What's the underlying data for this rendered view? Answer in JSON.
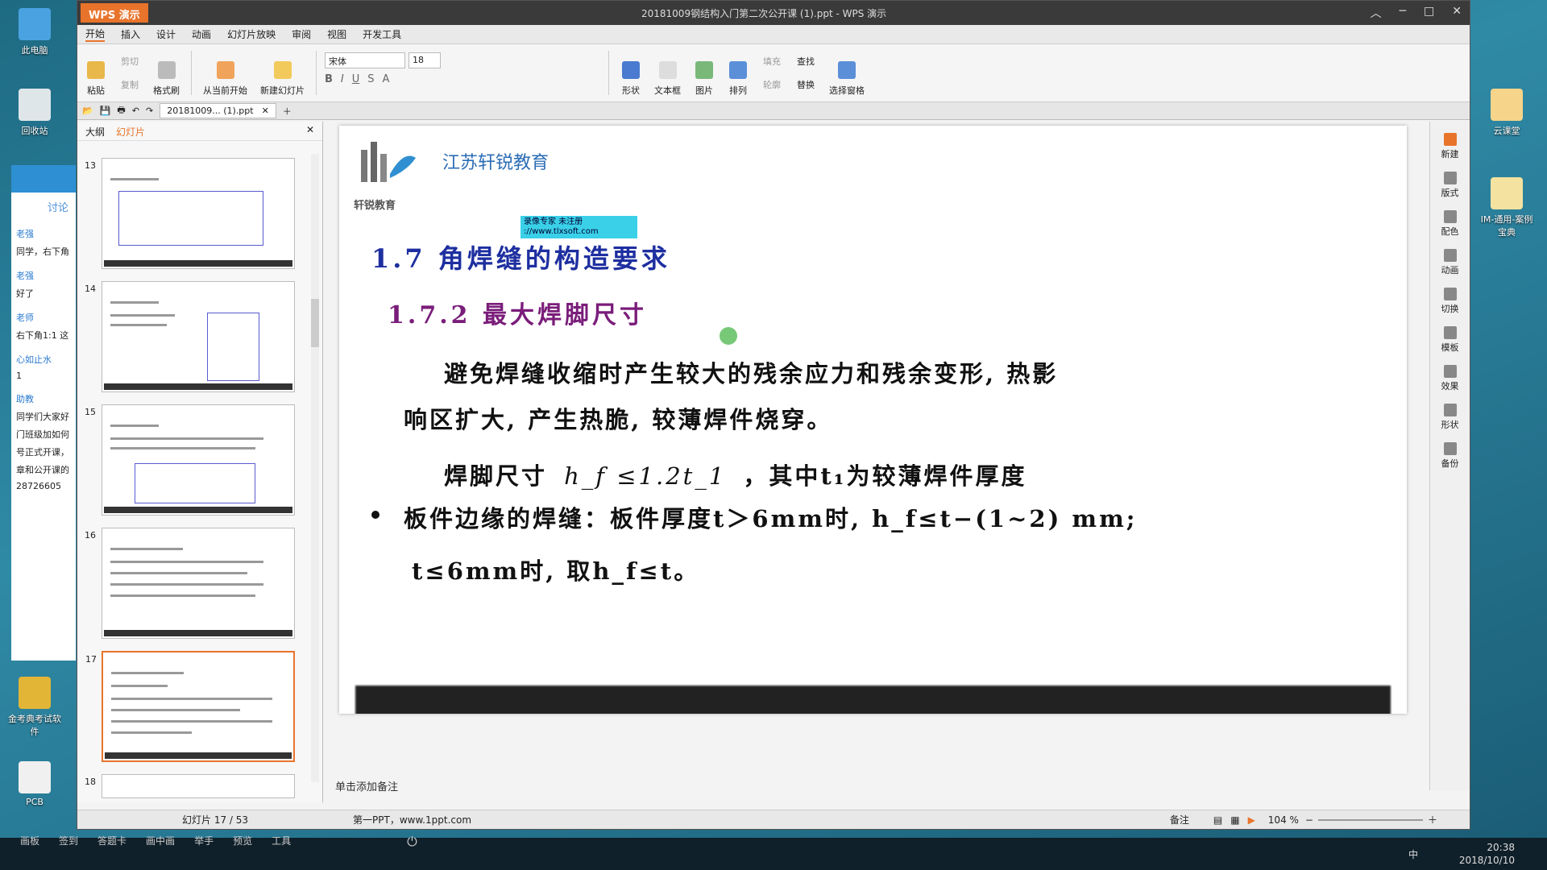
{
  "desktop": {
    "icons": [
      {
        "label": "此电脑"
      },
      {
        "label": "回收站"
      },
      {
        "label": "金考典考试软件"
      },
      {
        "label": "PCB"
      },
      {
        "label": "云课堂"
      },
      {
        "label": "IM-通用-案例宝典"
      }
    ]
  },
  "chat": {
    "tab": "讨论",
    "messages": [
      {
        "name": "老强",
        "text": "同学，右下角"
      },
      {
        "name": "老强",
        "text": "好了"
      },
      {
        "name": "老师",
        "text": "右下角1:1 这"
      },
      {
        "name": "心如止水",
        "text": "1"
      },
      {
        "name": "助教",
        "text": "同学们大家好"
      },
      {
        "name": "",
        "text": "门班级加如何"
      },
      {
        "name": "",
        "text": "号正式开课，"
      },
      {
        "name": "",
        "text": "章和公开课的"
      },
      {
        "name": "",
        "text": "28726605"
      }
    ]
  },
  "window": {
    "app_button": "WPS 演示",
    "title": "20181009钢结构入门第二次公开课 (1).ppt - WPS 演示",
    "menu": [
      "开始",
      "插入",
      "设计",
      "动画",
      "幻灯片放映",
      "审阅",
      "视图",
      "开发工具"
    ],
    "ribbon": {
      "paste": "粘贴",
      "cut": "剪切",
      "copy": "复制",
      "format_painter": "格式刷",
      "from_current": "从当前开始",
      "new_slide": "新建幻灯片",
      "font_name": "宋体",
      "font_size": "18",
      "shape": "形状",
      "textbox": "文本框",
      "picture": "图片",
      "arrange": "排列",
      "fill": "填充",
      "outline": "轮廓",
      "find": "查找",
      "replace": "替换",
      "selection_pane": "选择窗格"
    },
    "doc_tab": "20181009... (1).ppt"
  },
  "side": {
    "tab_outline": "大纲",
    "tab_slides": "幻灯片",
    "thumbs": [
      "13",
      "14",
      "15",
      "16",
      "17",
      "18"
    ]
  },
  "slide": {
    "org": "江苏轩锐教育",
    "logo_text": "轩锐教育",
    "watermark_line1": "录像专家   未注册",
    "watermark_line2": "://www.tlxsoft.com",
    "heading1": "1.7   角焊缝的构造要求",
    "heading2": "1.7.2   最大焊脚尺寸",
    "para1": "避免焊缝收缩时产生较大的残余应力和残余变形, 热影",
    "para2": "响区扩大, 产生热脆, 较薄焊件烧穿。",
    "formula_pre": "焊脚尺寸",
    "formula": "h_f ≤1.2t_1",
    "formula_post": "，其中t₁为较薄焊件厚度",
    "bullet1": "板件边缘的焊缝：板件厚度t＞6mm时, h_f≤t−(1~2) mm;",
    "bullet2": "t≤6mm时, 取h_f≤t。"
  },
  "notes_placeholder": "单击添加备注",
  "status": {
    "slide_count": "幻灯片 17 / 53",
    "template": "第一PPT，www.1ppt.com",
    "notes": "备注",
    "zoom": "104 %"
  },
  "right_pane": [
    "新建",
    "版式",
    "配色",
    "动画",
    "切换",
    "模板",
    "效果",
    "形状",
    "备份"
  ],
  "taskbar": {
    "tools": [
      "画板",
      "签到",
      "答题卡",
      "画中画",
      "举手",
      "预览",
      "工具"
    ],
    "time": "20:38",
    "date": "2018/10/10",
    "ime": "中"
  }
}
